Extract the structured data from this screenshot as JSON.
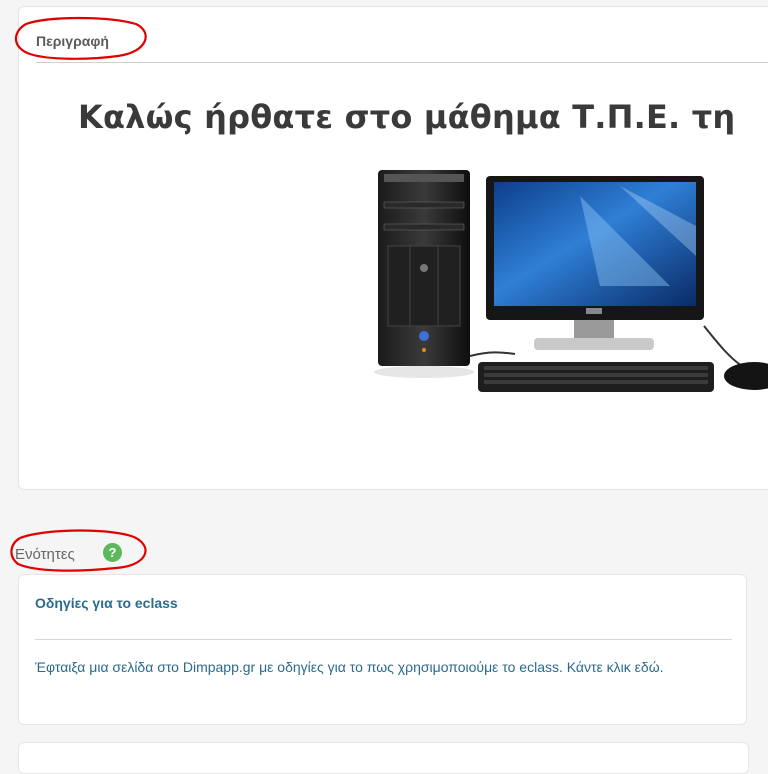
{
  "description": {
    "label": "Περιγραφή",
    "welcome_text": "Καλώς ήρθατε στο μάθημα Τ.Π.Ε. τη"
  },
  "units": {
    "label": "Ενότητες",
    "help_icon": "question-circle-icon",
    "items": [
      {
        "title": "Οδηγίες για το eclass",
        "text": "Έφταιξα μια σελίδα στο Dimpapp.gr με οδηγίες για το πως χρησιμοποιούμε το eclass. Κάντε κλικ εδώ."
      }
    ]
  },
  "colors": {
    "annotation": "#e00000",
    "link": "#2b6a8c",
    "help": "#5cb85c"
  }
}
